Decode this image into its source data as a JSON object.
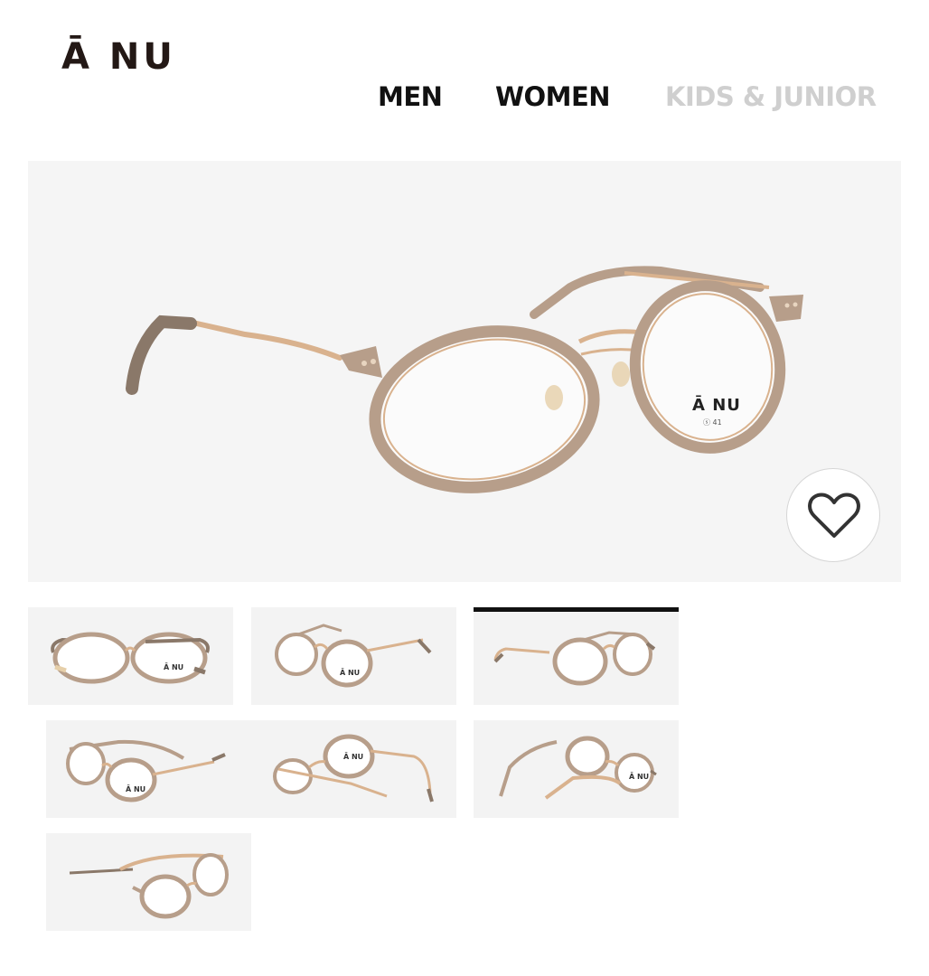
{
  "brand": {
    "logo": "Ā NU"
  },
  "nav": {
    "tabs": [
      {
        "label": "MEN",
        "state": "default"
      },
      {
        "label": "WOMEN",
        "state": "default"
      },
      {
        "label": "KIDS & JUNIOR",
        "state": "disabled"
      }
    ]
  },
  "product": {
    "main_image": {
      "lens_logo": "Ā NU",
      "lens_sub": "ⓢ 41"
    },
    "favorite": {
      "icon": "heart-outline-icon"
    },
    "frame_colors": {
      "rim": "#b79e8a",
      "rim_dark": "#8c7565",
      "metal": "#d9b28e",
      "tip": "#8a7869"
    },
    "thumbnails": [
      {
        "view": "front",
        "lens_logo": "Ā NU",
        "active": false
      },
      {
        "view": "front-left",
        "lens_logo": "Ā NU",
        "active": false
      },
      {
        "view": "front-right",
        "lens_logo": "",
        "active": true
      },
      {
        "view": "left-3/4",
        "lens_logo": "Ā NU",
        "active": false
      },
      {
        "view": "right-3/4",
        "lens_logo": "Ā NU",
        "active": false
      },
      {
        "view": "top-right",
        "lens_logo": "Ā NU",
        "active": false
      },
      {
        "view": "side",
        "lens_logo": "",
        "active": false
      }
    ]
  }
}
